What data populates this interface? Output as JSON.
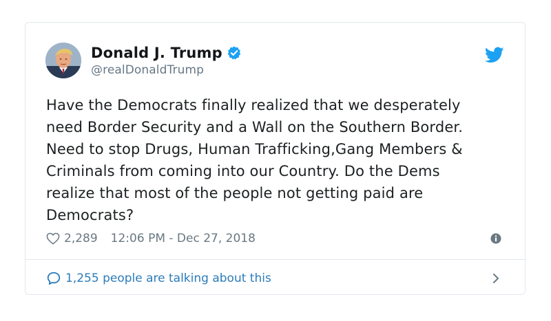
{
  "author": {
    "display_name": "Donald J. Trump",
    "handle": "@realDonaldTrump",
    "verified": true,
    "avatar_icon": "profile-photo"
  },
  "tweet": {
    "text": "Have the Democrats finally realized that we desperately\nneed Border Security and a Wall on the Southern Border.\nNeed to stop Drugs, Human Trafficking,Gang Members &\nCriminals from coming into our Country. Do the Dems\nrealize that most of the people not getting paid are\nDemocrats?"
  },
  "meta": {
    "likes": "2,289",
    "timestamp": "12:06 PM - Dec 27, 2018",
    "like_icon": "heart-icon",
    "info_icon": "info-icon"
  },
  "conversation": {
    "label": "1,255 people are talking about this",
    "icon": "speech-bubble-icon",
    "chevron_icon": "chevron-right-icon"
  },
  "branding": {
    "logo_icon": "twitter-bird-icon"
  },
  "colors": {
    "brand_blue": "#1da1f2",
    "link_blue": "#2b7bb9",
    "text": "#1c2022",
    "muted": "#697882",
    "border": "#e1e8ed"
  }
}
